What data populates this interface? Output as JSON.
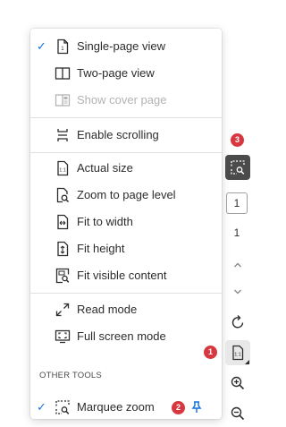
{
  "menu": {
    "items": [
      {
        "label": "Single-page view",
        "icon": "single-page-icon",
        "checked": true,
        "disabled": false
      },
      {
        "label": "Two-page view",
        "icon": "two-page-icon",
        "checked": false,
        "disabled": false
      },
      {
        "label": "Show cover page",
        "icon": "cover-page-icon",
        "checked": false,
        "disabled": true
      },
      {
        "label": "Enable scrolling",
        "icon": "scrolling-icon",
        "checked": false,
        "disabled": false
      },
      {
        "label": "Actual size",
        "icon": "actual-size-icon",
        "checked": false,
        "disabled": false
      },
      {
        "label": "Zoom to page level",
        "icon": "zoom-page-icon",
        "checked": false,
        "disabled": false
      },
      {
        "label": "Fit to width",
        "icon": "fit-width-icon",
        "checked": false,
        "disabled": false
      },
      {
        "label": "Fit height",
        "icon": "fit-height-icon",
        "checked": false,
        "disabled": false
      },
      {
        "label": "Fit visible content",
        "icon": "fit-visible-icon",
        "checked": false,
        "disabled": false
      },
      {
        "label": "Read mode",
        "icon": "read-mode-icon",
        "checked": false,
        "disabled": false
      },
      {
        "label": "Full screen mode",
        "icon": "full-screen-icon",
        "checked": false,
        "disabled": false
      }
    ],
    "other_tools_title": "OTHER TOOLS",
    "marquee": {
      "label": "Marquee zoom",
      "icon": "marquee-zoom-icon",
      "checked": true
    }
  },
  "checkmark": "✓",
  "badges": {
    "one": "1",
    "two": "2",
    "three": "3"
  },
  "toolbar": {
    "current_page": "1",
    "total_pages": "1"
  },
  "colors": {
    "accent": "#1473e6",
    "badge": "#d7373f",
    "active_tool_bg": "#4b4b4b",
    "text": "#2c2c2c",
    "disabled_text": "#b3b3b3"
  }
}
